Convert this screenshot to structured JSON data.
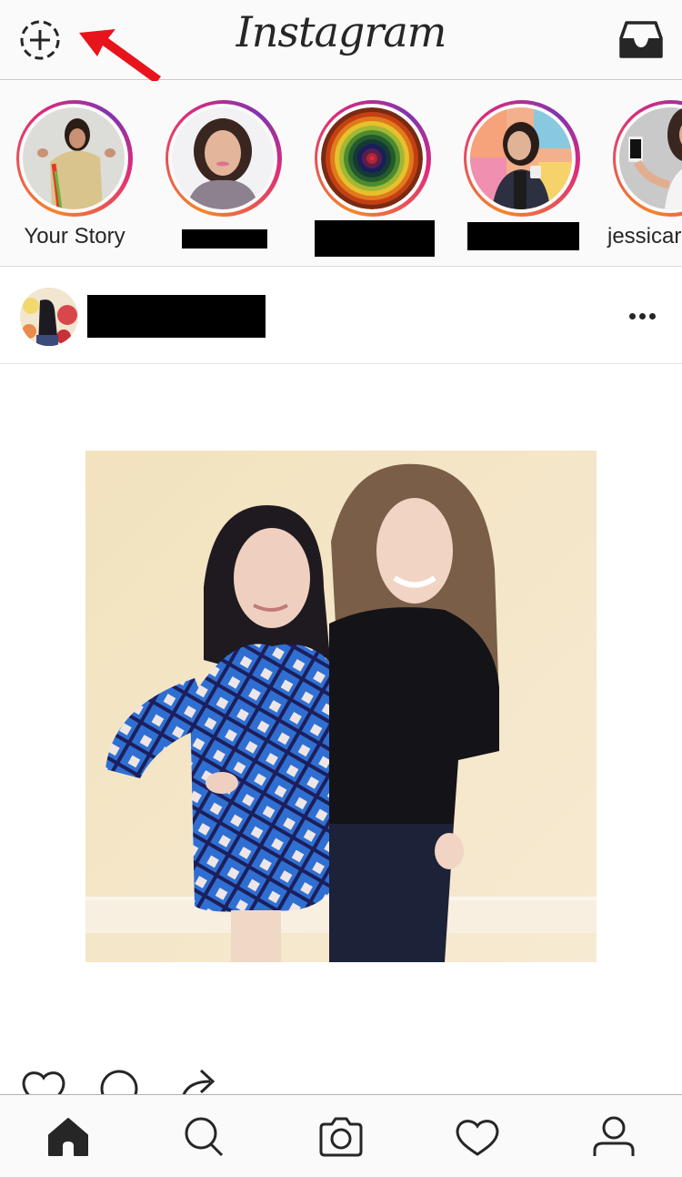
{
  "app": {
    "title": "Instagram",
    "accent_colors": {
      "ring_start": "#f58529",
      "ring_mid": "#dd2a7b",
      "ring_end": "#8134af",
      "annotation_arrow": "#e8141c"
    }
  },
  "topbar": {
    "logo_text": "Instagram",
    "new_story_icon": "dashed-circle-plus-icon",
    "inbox_icon": "inbox-tray-icon",
    "annotation": "red-arrow-pointing-to-new-story"
  },
  "stories": [
    {
      "label": "Your Story",
      "redacted": false,
      "picture": "woman-in-taco-costume"
    },
    {
      "label": "",
      "redacted": true,
      "picture": "woman-dark-curly-hair"
    },
    {
      "label": "",
      "redacted": true,
      "picture": "rainbow-concentric-circles"
    },
    {
      "label": "",
      "redacted": true,
      "picture": "woman-with-coffee-colorful-wall"
    },
    {
      "label": "jessicar",
      "redacted": false,
      "picture": "woman-holding-phone"
    }
  ],
  "post": {
    "username": "",
    "username_redacted": true,
    "more_icon": "more-dots-icon",
    "image_description": "Two women posing in front of a cream wall; left in blue plaid wrap dress, right in black top",
    "actions": [
      "like-icon",
      "comment-icon",
      "share-icon"
    ]
  },
  "tabbar": {
    "tabs": [
      {
        "name": "home",
        "icon": "home-icon",
        "active": true
      },
      {
        "name": "search",
        "icon": "search-icon",
        "active": false
      },
      {
        "name": "camera",
        "icon": "camera-icon",
        "active": false
      },
      {
        "name": "activity",
        "icon": "heart-icon",
        "active": false
      },
      {
        "name": "profile",
        "icon": "profile-icon",
        "active": false
      }
    ]
  }
}
